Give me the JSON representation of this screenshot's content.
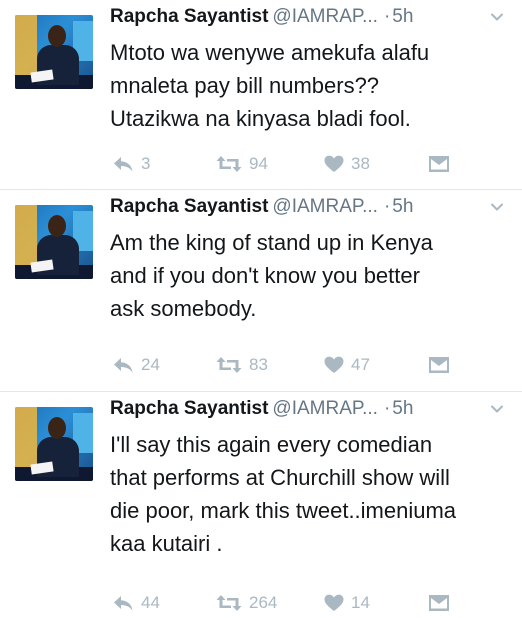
{
  "colors": {
    "muted": "#657786",
    "icon": "#aab8c2",
    "divider": "#e1e8ed"
  },
  "tweets": [
    {
      "name": "Rapcha Sayantist",
      "handle": "@IAMRAP...",
      "separator": "·",
      "time": "5h",
      "lines": [
        "Mtoto wa wenywe amekufa alafu",
        "mnaleta pay bill numbers??",
        "Utazikwa na kinyasa bladi fool."
      ],
      "replies": "3",
      "retweets": "94",
      "likes": "38"
    },
    {
      "name": "Rapcha Sayantist",
      "handle": "@IAMRAP...",
      "separator": "·",
      "time": "5h",
      "lines": [
        "Am the king of stand up in Kenya",
        "and if you don't know you better",
        "ask somebody."
      ],
      "replies": "24",
      "retweets": "83",
      "likes": "47"
    },
    {
      "name": "Rapcha Sayantist",
      "handle": "@IAMRAP...",
      "separator": "·",
      "time": "5h",
      "lines": [
        "I'll say this again every comedian",
        "that performs at Churchill show will",
        "die poor, mark this tweet..imeniuma",
        "kaa kutairi ."
      ],
      "replies": "44",
      "retweets": "264",
      "likes": "14"
    }
  ],
  "icons": {
    "avatar": "profile-photo",
    "caret": "chevron-down-icon",
    "reply": "reply-icon",
    "retweet": "retweet-icon",
    "like": "heart-icon",
    "dm": "envelope-icon"
  }
}
